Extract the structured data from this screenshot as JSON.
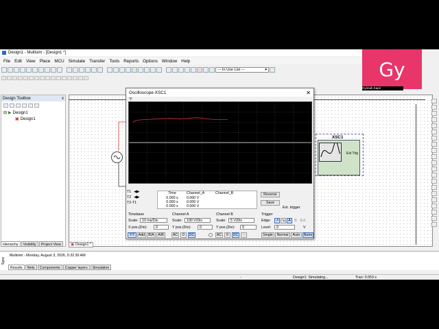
{
  "window": {
    "title": "Design1 - Multisim - [Design1 *]"
  },
  "menu": [
    "File",
    "Edit",
    "View",
    "Place",
    "MCU",
    "Simulate",
    "Transfer",
    "Tools",
    "Reports",
    "Options",
    "Window",
    "Help"
  ],
  "toolbar": {
    "in_use_list": "--- In Use List ---"
  },
  "design_toolbox": {
    "title": "Design Toolbox",
    "tree": [
      {
        "label": "Design1"
      },
      {
        "label": "Design1"
      }
    ],
    "tabs": [
      "Hierarchy",
      "Visibility",
      "Project View"
    ]
  },
  "doc_tab": "Design1 *",
  "oscilloscope": {
    "title": "Oscilloscope-XSC1",
    "readout": {
      "headers": [
        "Time",
        "Channel_A",
        "Channel_B"
      ],
      "rows": [
        {
          "label": "T1",
          "time": "0.000 s",
          "a": "0.000 V",
          "b": ""
        },
        {
          "label": "T2",
          "time": "0.000 s",
          "a": "0.000 V",
          "b": ""
        },
        {
          "label": "T2-T1",
          "time": "0.000 s",
          "a": "0.000 V",
          "b": ""
        }
      ],
      "reverse": "Reverse",
      "save": "Save",
      "ext_trigger": "Ext. trigger"
    },
    "timebase": {
      "title": "Timebase",
      "scale_label": "Scale:",
      "scale": "10 ms/Div",
      "xpos_label": "X pos.(Div):",
      "xpos": "0",
      "modes": [
        "Y/T",
        "Add",
        "B/A",
        "A/B"
      ]
    },
    "channel_a": {
      "title": "Channel A",
      "scale_label": "Scale:",
      "scale": "100  V/Div",
      "ypos_label": "Y pos.(Div):",
      "ypos": "0",
      "coupling": [
        "AC",
        "0",
        "DC"
      ]
    },
    "channel_b": {
      "title": "Channel B",
      "scale_label": "Scale:",
      "scale": "5  V/Div",
      "ypos_label": "Y pos.(Div):",
      "ypos": "0",
      "coupling": [
        "AC",
        "0",
        "DC",
        "-"
      ]
    },
    "trigger": {
      "title": "Trigger",
      "edge_label": "Edge:",
      "edge_buttons": [
        "A",
        "B",
        "Ext"
      ],
      "level_label": "Level:",
      "level": "0",
      "level_unit": "V",
      "modes": [
        "Single",
        "Normal",
        "Auto",
        "None"
      ]
    }
  },
  "component": {
    "name": "XSC1",
    "ext_trig": "Ext Trig"
  },
  "status": {
    "message": "Multisim  -  Monday, August 3, 2026, 5:32:30 AM",
    "side": "Spre",
    "tabs": [
      "Results",
      "Nets",
      "Components",
      "Copper layers",
      "Simulation"
    ],
    "bar_mid": "-",
    "bar_sim": "Design1: Simulating...",
    "bar_tran": "Tran: 0.053 s"
  },
  "camera": {
    "initials": "Gy",
    "name": "Gyimah Kapri"
  },
  "colors": {
    "trace": "#c0263a",
    "scope_bg": "#000000",
    "accent": "#e8356a"
  }
}
